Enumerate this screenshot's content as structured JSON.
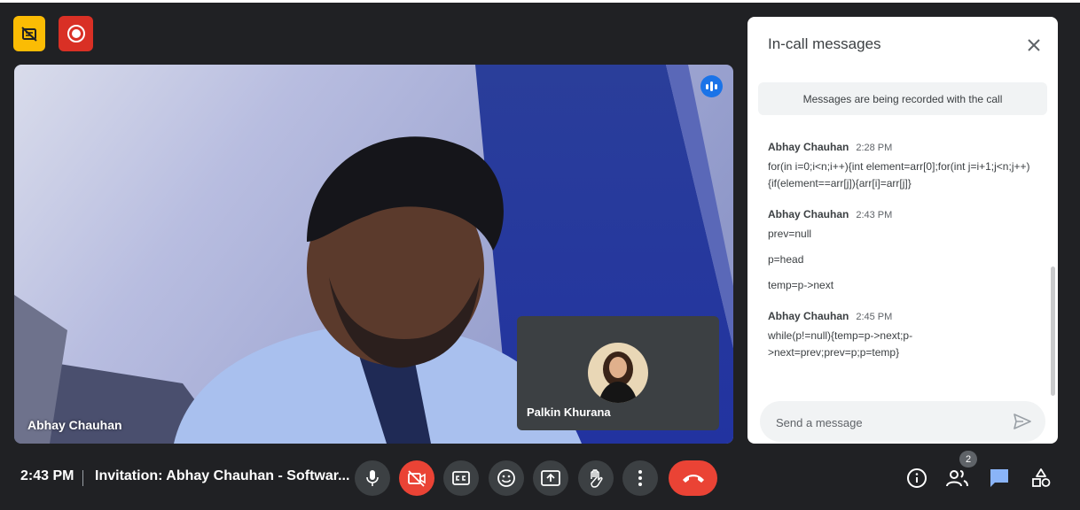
{
  "chat": {
    "title": "In-call messages",
    "recording_notice": "Messages are being recorded with the call",
    "messages": [
      {
        "author": "Abhay Chauhan",
        "time": "2:28 PM",
        "lines": [
          "for(in i=0;i<n;i++){int element=arr[0];for(int j=i+1;j<n;j++){if(element==arr[j]){arr[i]=arr[j]}"
        ]
      },
      {
        "author": "Abhay Chauhan",
        "time": "2:43 PM",
        "lines": [
          "prev=null",
          "p=head",
          "temp=p->next"
        ]
      },
      {
        "author": "Abhay Chauhan",
        "time": "2:45 PM",
        "lines": [
          "while(p!=null){temp=p->next;p->next=prev;prev=p;p=temp}"
        ]
      }
    ],
    "input_placeholder": "Send a message"
  },
  "video": {
    "main_participant": "Abhay Chauhan",
    "tile_participant": "Palkin Khurana"
  },
  "bottom_bar": {
    "time": "2:43 PM",
    "meeting_title": "Invitation: Abhay Chauhan - Softwar...",
    "participant_count": "2"
  },
  "icons": {
    "top": [
      "captions-off-icon",
      "recording-icon"
    ],
    "controls": [
      "mic-icon",
      "camera-off-icon",
      "captions-icon",
      "emoji-icon",
      "present-screen-icon",
      "raise-hand-icon",
      "more-options-icon",
      "end-call-icon"
    ],
    "right": [
      "info-icon",
      "people-icon",
      "chat-icon",
      "activities-icon"
    ]
  },
  "colors": {
    "accent": "#1a73e8",
    "danger": "#ea4335",
    "warning": "#fbbc04",
    "background": "#202124"
  }
}
